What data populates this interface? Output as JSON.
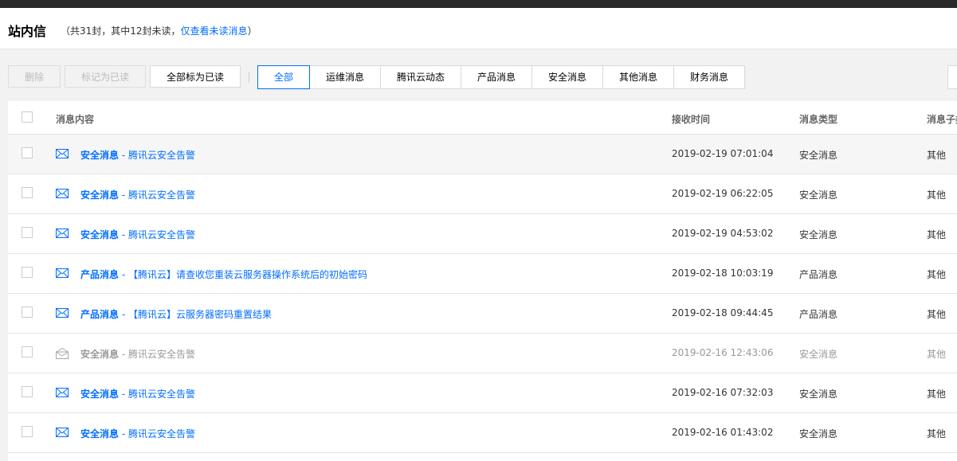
{
  "header": {
    "title": "站内信",
    "summary_prefix": "（共31封，其中12封未读，",
    "unread_only_link": "仅查看未读消息",
    "summary_suffix": "）"
  },
  "toolbar": {
    "delete_label": "删除",
    "mark_read_label": "标记为已读",
    "mark_all_read_label": "全部标为已读"
  },
  "tabs": [
    {
      "label": "全部",
      "active": true
    },
    {
      "label": "运维消息",
      "active": false
    },
    {
      "label": "腾讯云动态",
      "active": false
    },
    {
      "label": "产品消息",
      "active": false
    },
    {
      "label": "安全消息",
      "active": false
    },
    {
      "label": "其他消息",
      "active": false
    },
    {
      "label": "财务消息",
      "active": false
    }
  ],
  "table": {
    "columns": {
      "content": "消息内容",
      "time": "接收时间",
      "type": "消息类型",
      "subtype": "消息子类型"
    },
    "rows": [
      {
        "category": "安全消息",
        "sep": " - ",
        "title": "腾讯云安全告警",
        "time": "2019-02-19 07:01:04",
        "type": "安全消息",
        "subtype": "其他",
        "unread": true,
        "icon": "mail-closed-icon"
      },
      {
        "category": "安全消息",
        "sep": " - ",
        "title": "腾讯云安全告警",
        "time": "2019-02-19 06:22:05",
        "type": "安全消息",
        "subtype": "其他",
        "unread": true,
        "icon": "mail-closed-icon"
      },
      {
        "category": "安全消息",
        "sep": " - ",
        "title": "腾讯云安全告警",
        "time": "2019-02-19 04:53:02",
        "type": "安全消息",
        "subtype": "其他",
        "unread": true,
        "icon": "mail-closed-icon"
      },
      {
        "category": "产品消息",
        "sep": " - ",
        "title": "【腾讯云】请查收您重装云服务器操作系统后的初始密码",
        "time": "2019-02-18 10:03:19",
        "type": "产品消息",
        "subtype": "其他",
        "unread": true,
        "icon": "mail-closed-icon"
      },
      {
        "category": "产品消息",
        "sep": " - ",
        "title": "【腾讯云】云服务器密码重置结果",
        "time": "2019-02-18 09:44:45",
        "type": "产品消息",
        "subtype": "其他",
        "unread": true,
        "icon": "mail-closed-icon"
      },
      {
        "category": "安全消息",
        "sep": " - ",
        "title": "腾讯云安全告警",
        "time": "2019-02-16 12:43:06",
        "type": "安全消息",
        "subtype": "其他",
        "unread": false,
        "icon": "mail-open-icon"
      },
      {
        "category": "安全消息",
        "sep": " - ",
        "title": "腾讯云安全告警",
        "time": "2019-02-16 07:32:03",
        "type": "安全消息",
        "subtype": "其他",
        "unread": true,
        "icon": "mail-closed-icon"
      },
      {
        "category": "安全消息",
        "sep": " - ",
        "title": "腾讯云安全告警",
        "time": "2019-02-16 01:43:02",
        "type": "安全消息",
        "subtype": "其他",
        "unread": true,
        "icon": "mail-closed-icon"
      }
    ]
  },
  "colors": {
    "accent": "#006eff",
    "read_text": "#999999"
  }
}
